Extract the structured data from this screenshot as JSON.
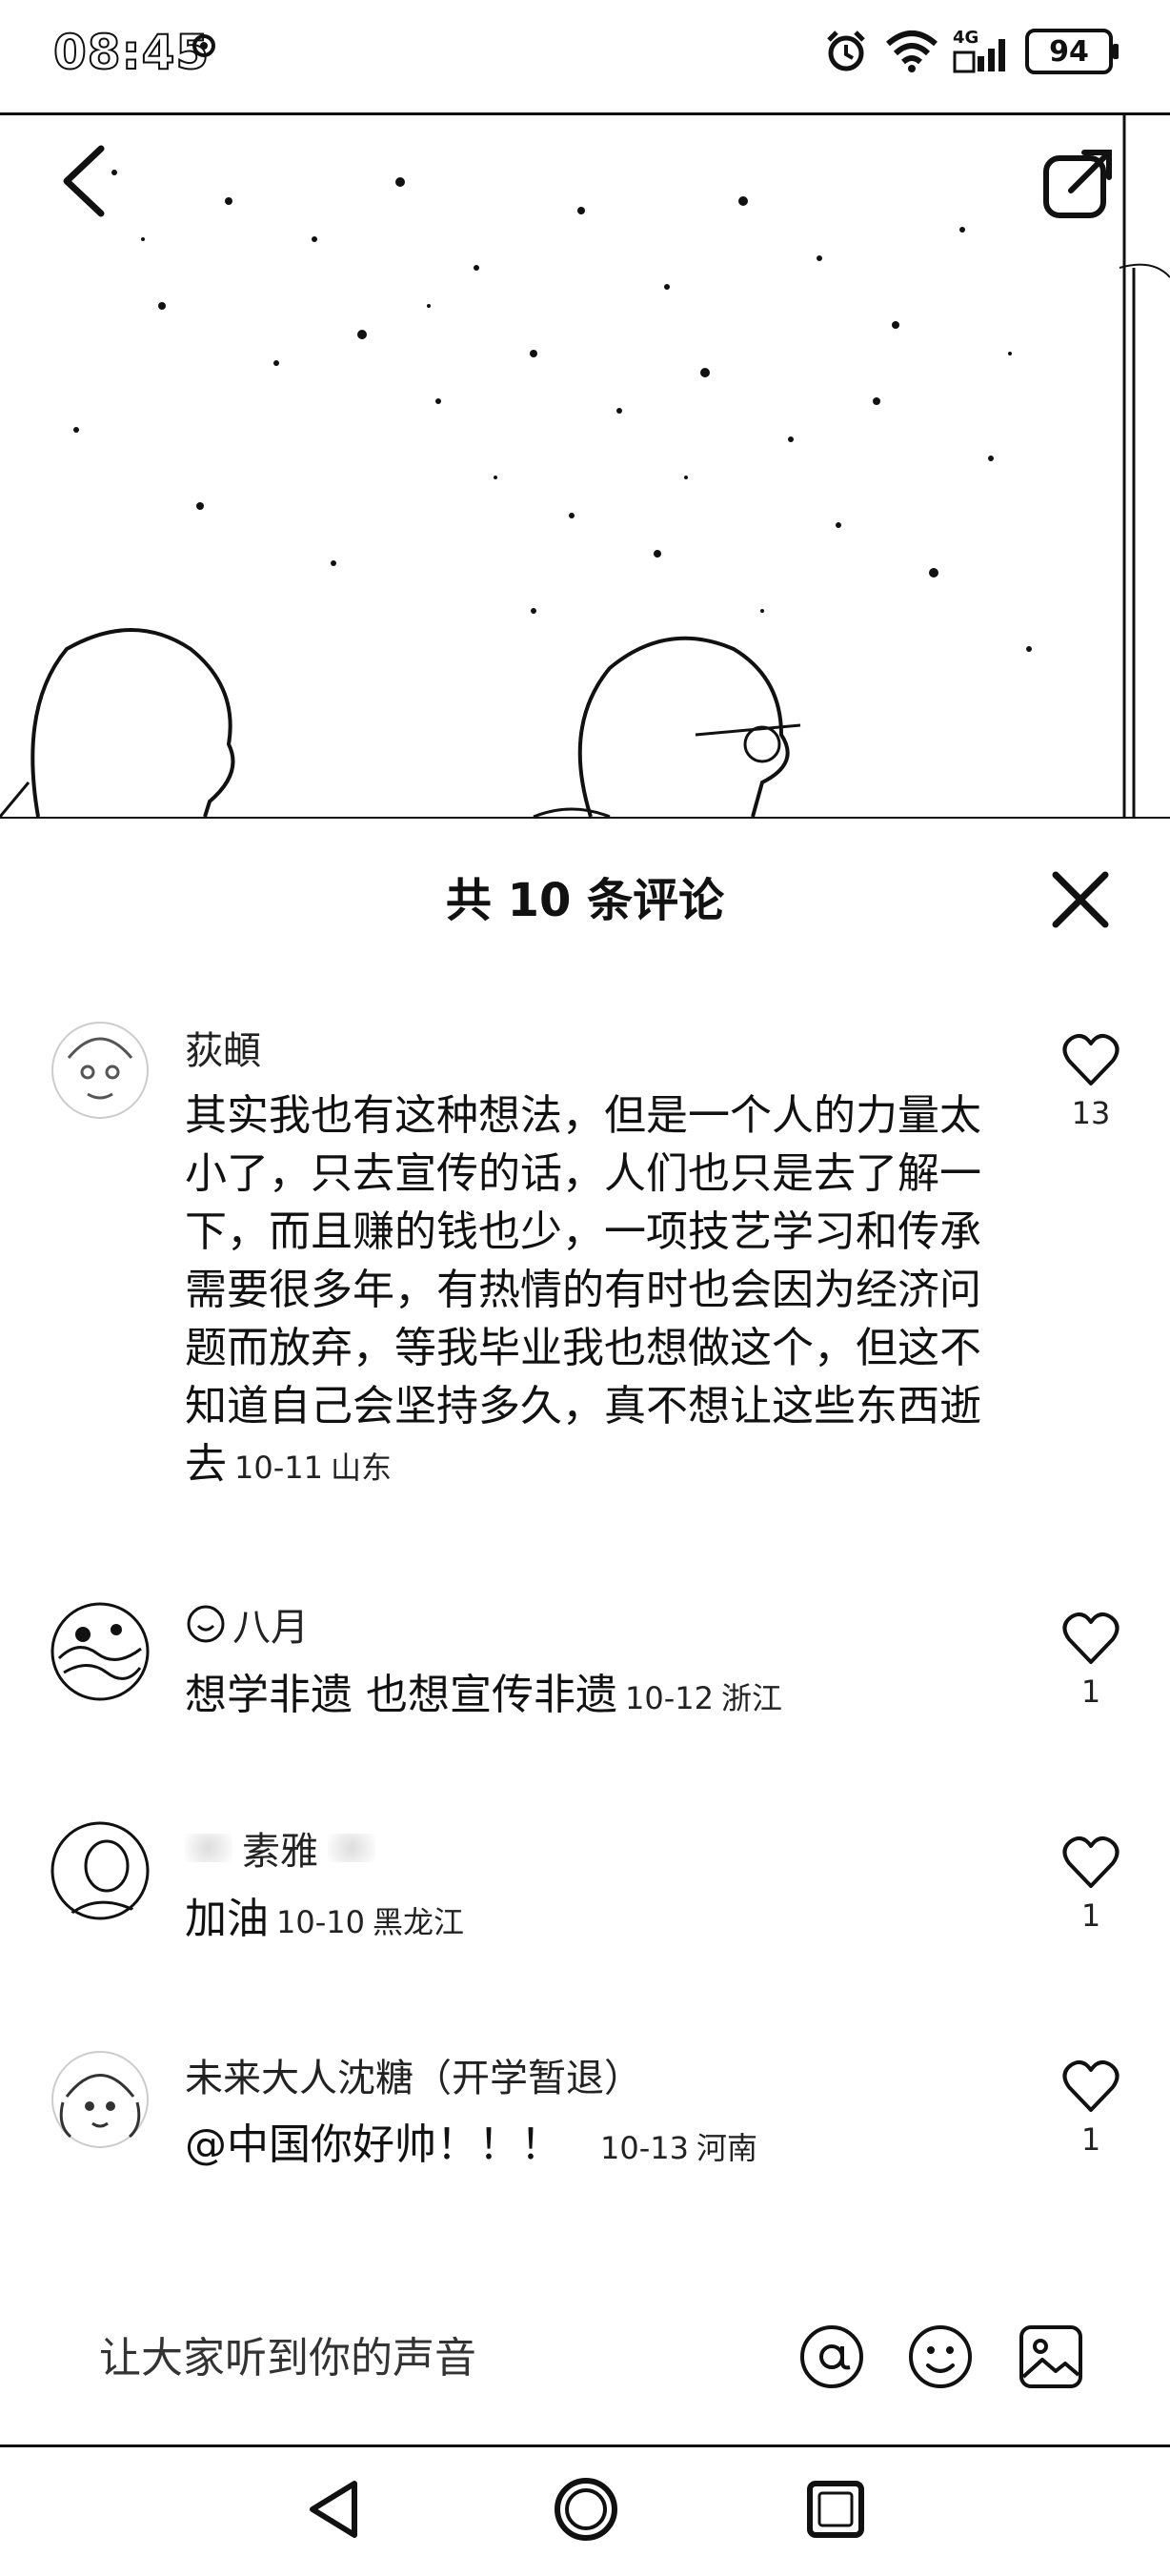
{
  "status_bar": {
    "time": "08:45",
    "network": "4G",
    "battery": "94",
    "icons": [
      "notification-dot-icon",
      "alarm-icon",
      "wifi-icon",
      "signal-icon",
      "battery-icon"
    ]
  },
  "media": {
    "back_icon": "chevron-left-icon",
    "share_icon": "share-external-icon"
  },
  "comments": {
    "title": "共 10 条评论",
    "close_icon": "close-icon",
    "items": [
      {
        "username": "荻頔",
        "text": "其实我也有这种想法，但是一个人的力量太小了，只去宣传的话，人们也只是去了解一下，而且赚的钱也少，一项技艺学习和传承需要很多年，有热情的有时也会因为经济问题而放弃，等我毕业我也想做这个，但这不知道自己会坚持多久，真不想让这些东西逝去",
        "date": "10-11",
        "location": "山东",
        "likes": "13"
      },
      {
        "username": "八月",
        "text": "想学非遗 也想宣传非遗",
        "date": "10-12",
        "location": "浙江",
        "likes": "1"
      },
      {
        "username": "素雅",
        "text": "加油",
        "date": "10-10",
        "location": "黑龙江",
        "likes": "1"
      },
      {
        "username": "未来大人沈糖（开学暂退）",
        "text": "@中国你好帅！！！",
        "date": "10-13",
        "location": "河南",
        "likes": "1"
      }
    ]
  },
  "input_bar": {
    "placeholder": "让大家听到你的声音",
    "icons": [
      "at-icon",
      "emoji-icon",
      "image-icon"
    ]
  },
  "nav_bar": {
    "icons": [
      "back-triangle-icon",
      "home-circle-icon",
      "recents-square-icon"
    ]
  }
}
